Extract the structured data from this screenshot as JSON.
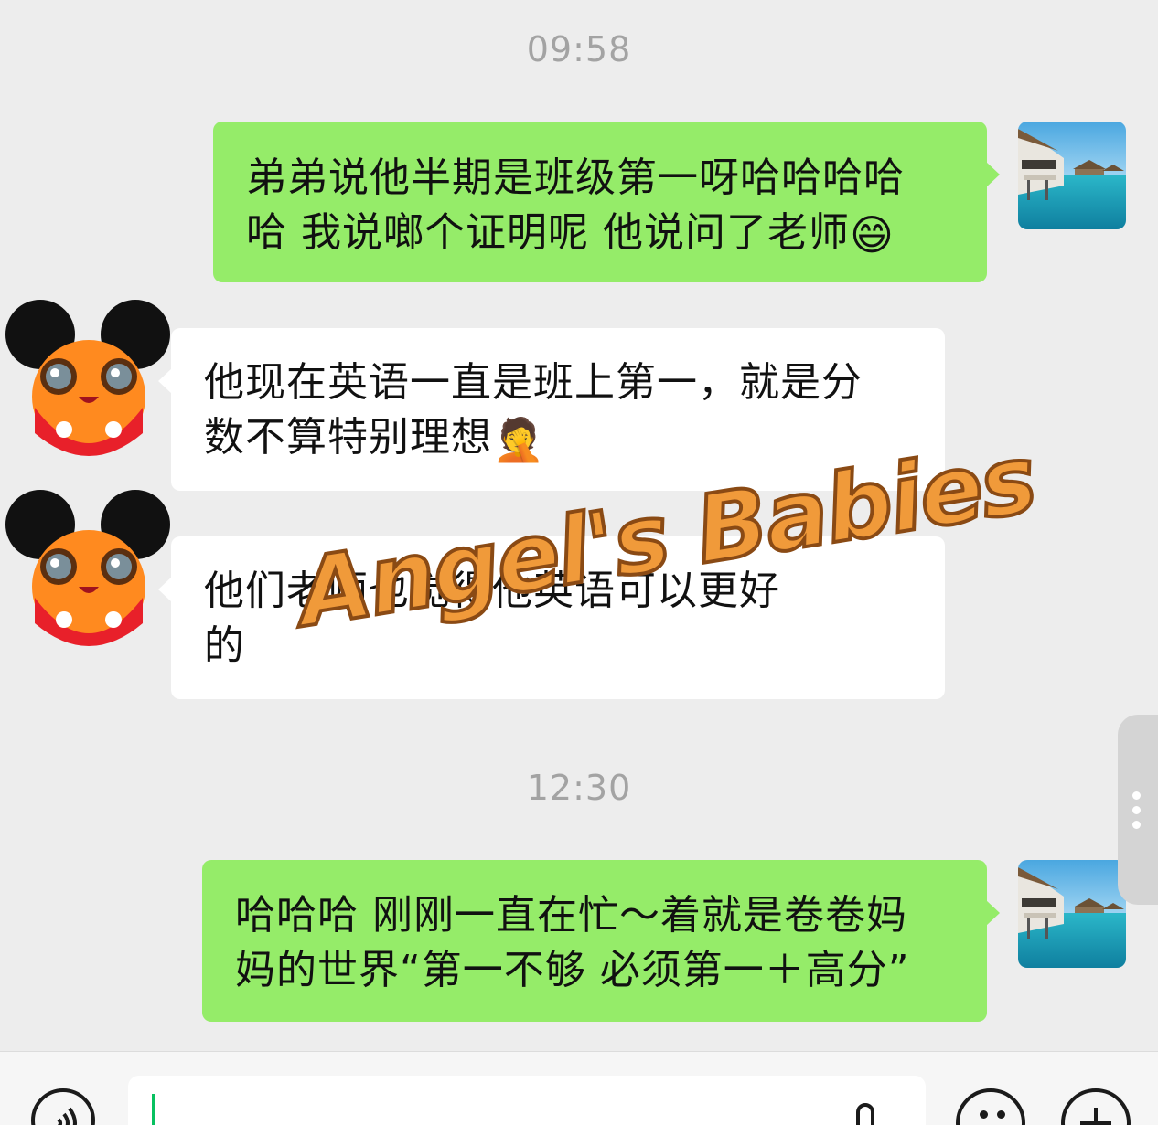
{
  "messages": [
    {
      "type": "time",
      "text": "09:58"
    },
    {
      "type": "sent",
      "text": "弟弟说他半期是班级第一呀哈哈哈哈哈 我说啷个证明呢 他说问了老师",
      "emoji": "😄"
    },
    {
      "type": "received",
      "text": "他现在英语一直是班上第一，就是分数不算特别理想",
      "emoji": "🤦"
    },
    {
      "type": "received",
      "text": "他们老师也觉得他英语可以更好的",
      "emoji": ""
    },
    {
      "type": "time",
      "text": "12:30"
    },
    {
      "type": "sent",
      "text": "哈哈哈 刚刚一直在忙～着就是卷卷妈妈的世界“第一不够 必须第一＋高分”",
      "emoji": ""
    }
  ],
  "lines": {
    "m1_l1": "弟弟说他半期是班级第一呀哈哈哈哈",
    "m1_l2": "哈 我说啷个证明呢 他说问了老师",
    "m2_l1": "他现在英语一直是班上第一，就是分",
    "m2_l2": "数不算特别理想",
    "m3_l1": "他们老师也觉得他英语可以更好",
    "m3_l2": "的",
    "m4_l1": "哈哈哈 刚刚一直在忙～着就是卷卷妈",
    "m4_l2": "妈的世界“第一不够 必须第一＋高分”"
  },
  "watermark": "Angel's Babies",
  "icons": {
    "voice": "voice-icon",
    "microphone": "microphone-icon",
    "emoji": "emoji-icon",
    "more": "plus-icon",
    "handle": "more-dots-icon"
  },
  "colors": {
    "background": "#ededed",
    "sent_bubble": "#95ec69",
    "received_bubble": "#ffffff",
    "time_text": "#a3a3a3",
    "cursor": "#07c160",
    "watermark": "#f09a3a"
  }
}
